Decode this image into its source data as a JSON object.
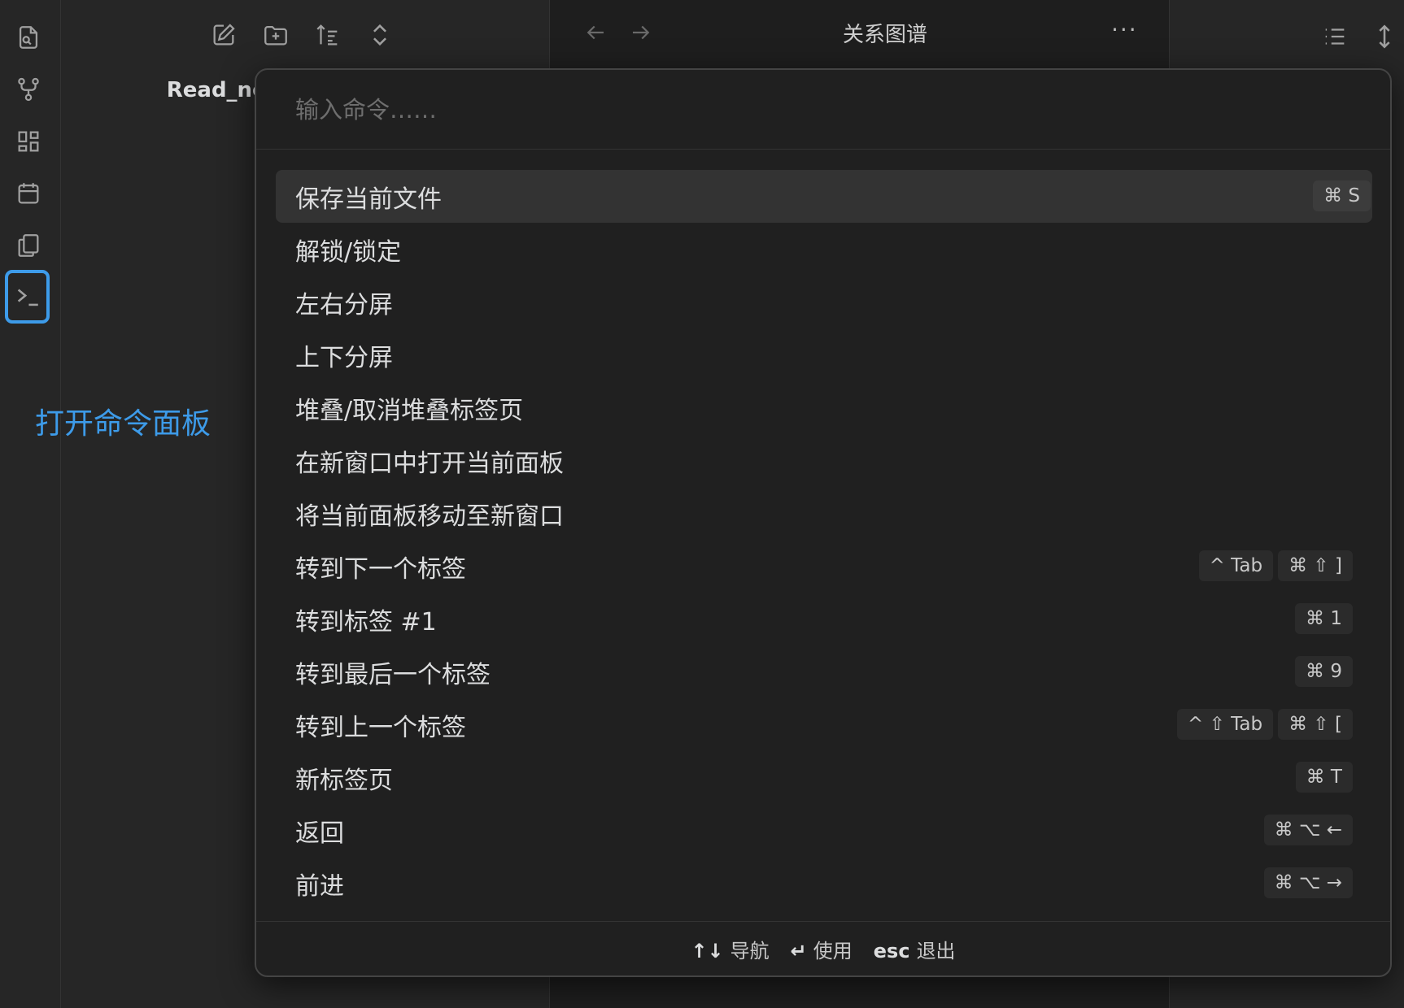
{
  "ribbon": {
    "icons": [
      "file-search-icon",
      "graph-icon",
      "dashboard-icon",
      "calendar-icon",
      "copy-icon",
      "terminal-icon"
    ]
  },
  "explorer": {
    "toolbar": [
      "new-note-icon",
      "new-folder-icon",
      "sort-icon",
      "collapse-expand-icon"
    ],
    "vault_name": "Read_note"
  },
  "annotation": "打开命令面板",
  "tab": {
    "title": "关系图谱",
    "more": "···"
  },
  "palette": {
    "placeholder": "输入命令……",
    "commands": [
      {
        "label": "保存当前文件",
        "hotkeys": [
          "⌘ S"
        ],
        "selected": true
      },
      {
        "label": "解锁/锁定",
        "hotkeys": []
      },
      {
        "label": "左右分屏",
        "hotkeys": []
      },
      {
        "label": "上下分屏",
        "hotkeys": []
      },
      {
        "label": "堆叠/取消堆叠标签页",
        "hotkeys": []
      },
      {
        "label": "在新窗口中打开当前面板",
        "hotkeys": []
      },
      {
        "label": "将当前面板移动至新窗口",
        "hotkeys": []
      },
      {
        "label": "转到下一个标签",
        "hotkeys": [
          "^ Tab",
          "⌘ ⇧ ]"
        ]
      },
      {
        "label": "转到标签 #1",
        "hotkeys": [
          "⌘ 1"
        ]
      },
      {
        "label": "转到最后一个标签",
        "hotkeys": [
          "⌘ 9"
        ]
      },
      {
        "label": "转到上一个标签",
        "hotkeys": [
          "^ ⇧ Tab",
          "⌘ ⇧ ["
        ]
      },
      {
        "label": "新标签页",
        "hotkeys": [
          "⌘ T"
        ]
      },
      {
        "label": "返回",
        "hotkeys": [
          "⌘ ⌥ ←"
        ]
      },
      {
        "label": "前进",
        "hotkeys": [
          "⌘ ⌥ →"
        ]
      }
    ],
    "footer": [
      {
        "key": "↑↓",
        "text": "导航"
      },
      {
        "key": "↵",
        "text": "使用"
      },
      {
        "key": "esc",
        "text": "退出"
      }
    ]
  },
  "colors": {
    "accent": "#3d9be9",
    "background": "#1e1e1e",
    "panel": "#262626",
    "selected": "#333333"
  }
}
